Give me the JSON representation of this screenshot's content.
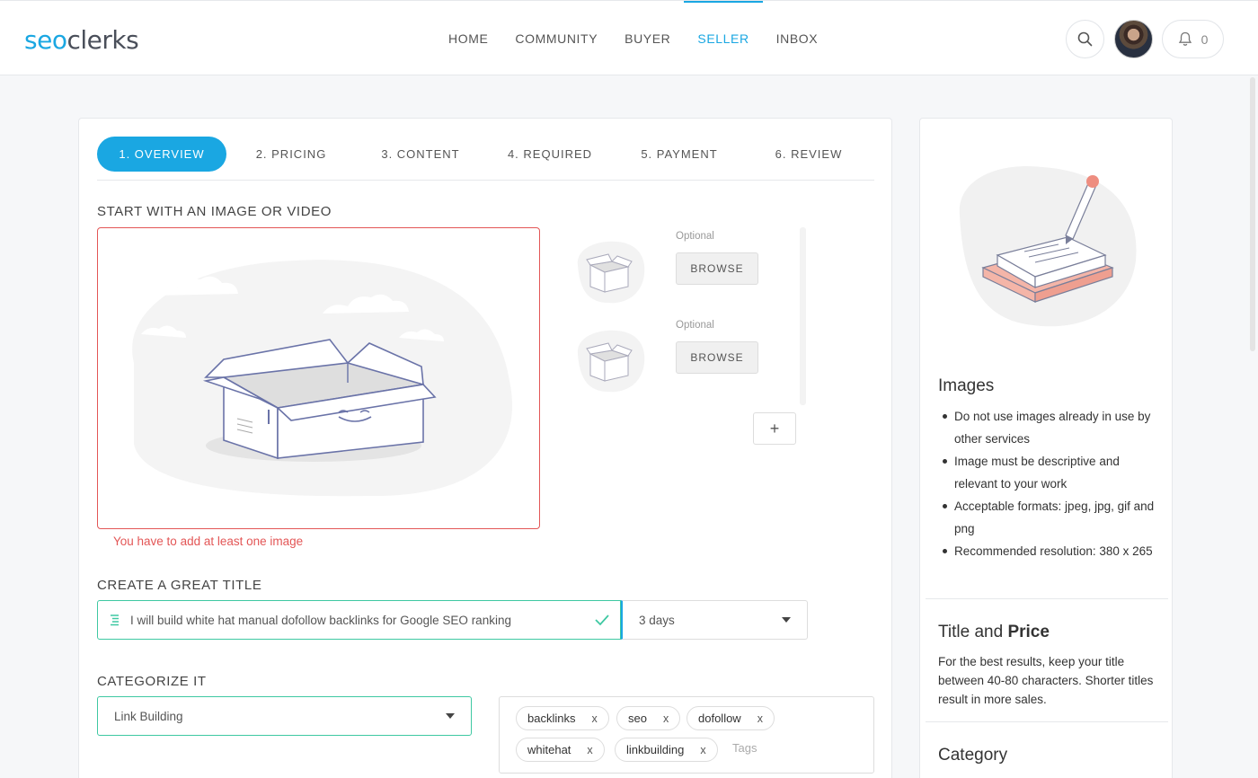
{
  "header": {
    "logo_part1": "seo",
    "logo_part2": "clerks",
    "nav": [
      "HOME",
      "COMMUNITY",
      "BUYER",
      "SELLER",
      "INBOX"
    ],
    "active_nav": "SELLER",
    "notification_count": "0",
    "icons": [
      "search-icon",
      "bell-icon"
    ]
  },
  "tabs": [
    "1. OVERVIEW",
    "2. PRICING",
    "3. CONTENT",
    "4. REQUIRED",
    "5. PAYMENT",
    "6. REVIEW"
  ],
  "active_tab": "1. OVERVIEW",
  "media": {
    "section_title": "START WITH AN IMAGE OR VIDEO",
    "error": "You have to add at least one image",
    "slots": [
      {
        "optional_label": "Optional",
        "button": "BROWSE"
      },
      {
        "optional_label": "Optional",
        "button": "BROWSE"
      }
    ],
    "add_button": "+"
  },
  "title_section": {
    "section_title": "CREATE A GREAT TITLE",
    "value": "I will build white hat manual dofollow backlinks for Google SEO ranking",
    "delivery": "3 days"
  },
  "category_section": {
    "section_title": "CATEGORIZE IT",
    "category": "Link Building",
    "tags": [
      "backlinks",
      "seo",
      "dofollow",
      "whitehat",
      "linkbuilding"
    ],
    "tag_remove": "x",
    "tags_placeholder": "Tags"
  },
  "sidebar": {
    "images_title": "Images",
    "images_tips": [
      "Do not use images already in use by other services",
      "Image must be descriptive and relevant to your work",
      "Acceptable formats: jpeg, jpg, gif and png",
      "Recommended resolution: 380 x 265"
    ],
    "title_price_title_a": "Title and",
    "title_price_title_b": "Price",
    "title_price_text": "For the best results, keep your title between 40-80 characters. Shorter titles result in more sales.",
    "category_title": "Category"
  },
  "colors": {
    "accent": "#1aa7e2",
    "error": "#e35656",
    "valid": "#3ec8a2"
  }
}
